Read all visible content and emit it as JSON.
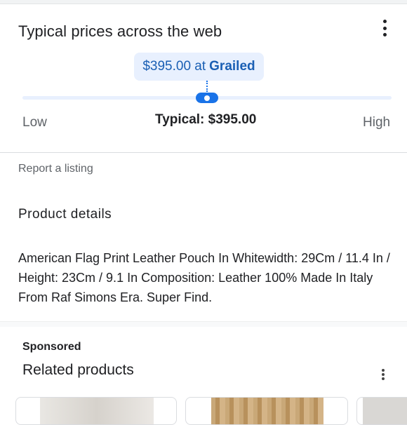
{
  "prices_card": {
    "title": "Typical prices across the web",
    "tooltip_price": "$395.00 at",
    "tooltip_store": "Grailed",
    "slider_position": 0.5,
    "low_label": "Low",
    "high_label": "High",
    "typical_label": "Typical: $395.00"
  },
  "report_link": "Report a listing",
  "product_details": {
    "heading": "Product details",
    "description": "American Flag Print Leather Pouch In Whitewidth: 29Cm / 11.4 In / Height: 23Cm / 9.1 In Composition: Leather 100% Made In Italy From Raf Simons Era. Super Find."
  },
  "related": {
    "sponsored_label": "Sponsored",
    "title": "Related products"
  },
  "colors": {
    "accent": "#1a73e8",
    "tooltip_bg": "#e8f0fe",
    "tooltip_text": "#1a5fb4"
  }
}
